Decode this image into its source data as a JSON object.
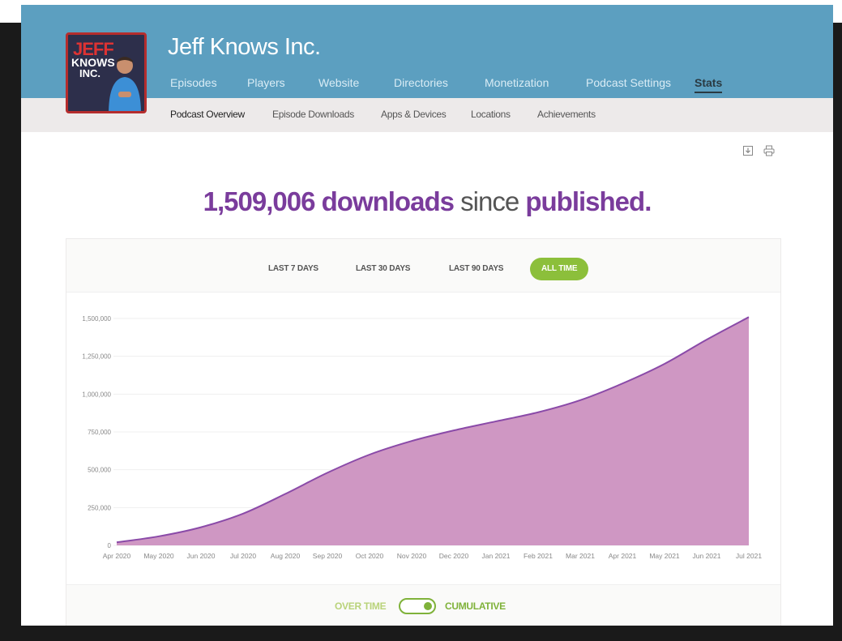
{
  "app": {
    "podcast_title": "Jeff Knows Inc.",
    "cover_art": {
      "line1": "JEFF",
      "line2": "KNOWS",
      "line3": "INC."
    }
  },
  "main_nav": [
    {
      "label": "Episodes",
      "active": false
    },
    {
      "label": "Players",
      "active": false
    },
    {
      "label": "Website",
      "active": false
    },
    {
      "label": "Directories",
      "active": false
    },
    {
      "label": "Monetization",
      "active": false
    },
    {
      "label": "Podcast Settings",
      "active": false
    },
    {
      "label": "Stats",
      "active": true
    }
  ],
  "sub_nav": [
    {
      "label": "Podcast Overview",
      "active": true
    },
    {
      "label": "Episode Downloads",
      "active": false
    },
    {
      "label": "Apps & Devices",
      "active": false
    },
    {
      "label": "Locations",
      "active": false
    },
    {
      "label": "Achievements",
      "active": false
    }
  ],
  "tools": {
    "download_icon": "download-icon",
    "print_icon": "print-icon"
  },
  "headline": {
    "count": "1,509,006",
    "word_downloads": "downloads",
    "word_since": "since",
    "word_published": "published."
  },
  "range_buttons": [
    {
      "label": "LAST 7 DAYS",
      "active": false
    },
    {
      "label": "LAST 30 DAYS",
      "active": false
    },
    {
      "label": "LAST 90 DAYS",
      "active": false
    },
    {
      "label": "ALL TIME",
      "active": true
    }
  ],
  "toggle": {
    "left_label": "OVER TIME",
    "right_label": "CUMULATIVE",
    "mode": "cumulative"
  },
  "colors": {
    "header": "#5c9fc0",
    "accent_purple": "#7a3c9c",
    "area_fill": "#cf97c3",
    "line": "#8a4aa8",
    "active_green": "#8cbf3b"
  },
  "chart_data": {
    "type": "area",
    "title": "",
    "xlabel": "",
    "ylabel": "",
    "categories": [
      "Apr 2020",
      "May 2020",
      "Jun 2020",
      "Jul 2020",
      "Aug 2020",
      "Sep 2020",
      "Oct 2020",
      "Nov 2020",
      "Dec 2020",
      "Jan 2021",
      "Feb 2021",
      "Mar 2021",
      "Apr 2021",
      "May 2021",
      "Jun 2021",
      "Jul 2021"
    ],
    "values": [
      20000,
      60000,
      120000,
      210000,
      340000,
      480000,
      600000,
      690000,
      760000,
      820000,
      880000,
      960000,
      1070000,
      1200000,
      1360000,
      1509006
    ],
    "y_ticks": [
      0,
      250000,
      500000,
      750000,
      1000000,
      1250000,
      1500000
    ],
    "y_tick_labels": [
      "0",
      "250,000",
      "500,000",
      "750,000",
      "1,000,000",
      "1,250,000",
      "1,500,000"
    ],
    "ylim": [
      0,
      1500000
    ],
    "grid": true,
    "legend": "none"
  }
}
